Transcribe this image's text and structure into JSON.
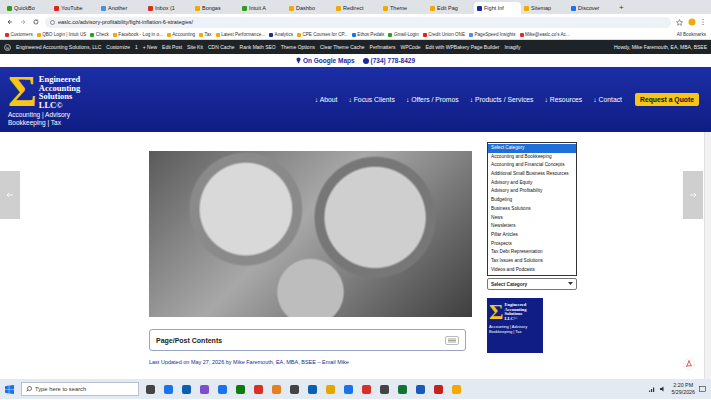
{
  "browser": {
    "tabs": [
      {
        "label": "QuickBo",
        "selected": false
      },
      {
        "label": "YouTube",
        "selected": false
      },
      {
        "label": "Another",
        "selected": false
      },
      {
        "label": "Inbox (1",
        "selected": false
      },
      {
        "label": "Bongas",
        "selected": false
      },
      {
        "label": "Intuit A",
        "selected": false
      },
      {
        "label": "Dashbo",
        "selected": false
      },
      {
        "label": "Redirect",
        "selected": false
      },
      {
        "label": "Theme",
        "selected": false
      },
      {
        "label": "Edit Pag",
        "selected": false
      },
      {
        "label": "Fight Inf",
        "selected": true
      },
      {
        "label": "Sitemap",
        "selected": false
      },
      {
        "label": "Discover",
        "selected": false
      }
    ],
    "new_tab": "+",
    "address": "easlc.co/advisory-profitability/fight-inflation-6-strategies/",
    "bookmarks": [
      "Customers",
      "QBO Login | Intuit US",
      "Check",
      "Facebook - Log in o...",
      "Accounting",
      "Tax",
      "Latest Performance...",
      "Analytics",
      "CPE Courses for CP...",
      "Ethos Pedals",
      "Gmail-Login",
      "Credit Union ONE",
      "PageSpeed Insights",
      "Mike@easlc.co's Ac..."
    ],
    "all_bookmarks": "All Bookmarks"
  },
  "admin_bar": {
    "site": "Engineered Accounting Solutions, LLC",
    "items": [
      "Customize",
      "1",
      "+ New",
      "Edit Post",
      "Site Kit",
      "CDN Cache",
      "Rank Math SEO",
      "Theme Options",
      "Clear Theme Cache",
      "Perfmatters",
      "WPCode",
      "Edit with WPBakery Page Builder",
      "Imagify"
    ],
    "howdy": "Howdy, Mike Faremouth, EA, MBA, BSEE"
  },
  "top_strip": {
    "maps": "On Google Maps",
    "phone": "(734) 778-8429"
  },
  "header": {
    "logo": {
      "sigma": "Σ",
      "lines": [
        "Engineered",
        "Accounting",
        "Solutions",
        "LLC©"
      ],
      "tagline": [
        "Accounting | Advisory",
        "Bookkeeping | Tax"
      ]
    },
    "nav": [
      "↓ About",
      "↓ Focus Clients",
      "↓ Offers / Promos",
      "↓ Products / Services",
      "↓ Resources",
      "↓ Contact"
    ],
    "cta": "Request a Quote"
  },
  "sidebar": {
    "category_options": [
      {
        "label": "Select Category",
        "selected": true
      },
      {
        "label": "Accounting and Bookkeeping",
        "selected": false
      },
      {
        "label": "Accounting and Financial Concepts",
        "selected": false
      },
      {
        "label": "Additional Small Business Resources",
        "selected": false
      },
      {
        "label": "Advisory and Equity",
        "selected": false
      },
      {
        "label": "Advisory and Profitability",
        "selected": false
      },
      {
        "label": "Budgeting",
        "selected": false
      },
      {
        "label": "Business Solutions",
        "selected": false
      },
      {
        "label": "News",
        "selected": false
      },
      {
        "label": "Newsletters",
        "selected": false
      },
      {
        "label": "Pillar Articles",
        "selected": false
      },
      {
        "label": "Prospects",
        "selected": false
      },
      {
        "label": "Tax Debt Representation",
        "selected": false
      },
      {
        "label": "Tax Issues and Solutions",
        "selected": false
      },
      {
        "label": "Videos and Podcasts",
        "selected": false
      }
    ],
    "select_label": "Select Category",
    "logo": {
      "sigma": "Σ",
      "lines": [
        "Engineered",
        "Accounting",
        "Solutions",
        "LLC©"
      ],
      "tagline": "Accounting | Advisory Bookkeeping | Tax"
    }
  },
  "article": {
    "toc_title": "Page/Post Contents",
    "updated": "Last Updated on May 27, 2026 by Mike Faremouth, EA, MBA, BSEE – Email Mike"
  },
  "taskbar": {
    "search": "Type here to search",
    "time": "2:20 PM",
    "date": "5/29/2026"
  }
}
